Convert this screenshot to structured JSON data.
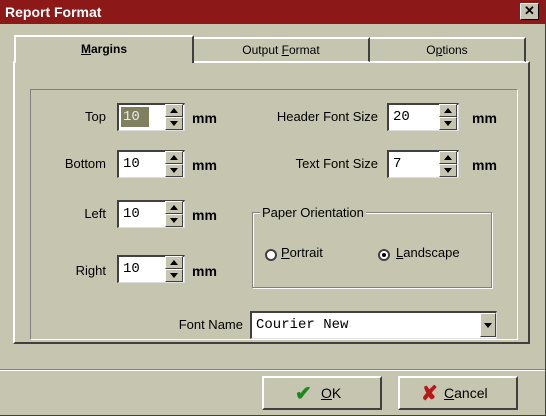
{
  "window": {
    "title": "Report Format",
    "close_glyph": "✕"
  },
  "tabs": [
    {
      "label_pre": "",
      "label_key": "M",
      "label_post": "argins"
    },
    {
      "label_pre": "Output ",
      "label_key": "F",
      "label_post": "ormat"
    },
    {
      "label_pre": "O",
      "label_key": "p",
      "label_post": "tions"
    }
  ],
  "margins": {
    "top": {
      "label": "Top",
      "value": "10",
      "unit": "mm"
    },
    "bottom": {
      "label": "Bottom",
      "value": "10",
      "unit": "mm"
    },
    "left": {
      "label": "Left",
      "value": "10",
      "unit": "mm"
    },
    "right": {
      "label": "Right",
      "value": "10",
      "unit": "mm"
    }
  },
  "header_font_size": {
    "label": "Header Font Size",
    "value": "20",
    "unit": "mm"
  },
  "text_font_size": {
    "label": "Text Font Size",
    "value": "7",
    "unit": "mm"
  },
  "paper_orientation": {
    "title": "Paper Orientation",
    "options": [
      {
        "key": "P",
        "rest": "ortrait",
        "selected": false
      },
      {
        "key": "L",
        "rest": "andscape",
        "selected": true
      }
    ]
  },
  "font_name": {
    "label": "Font Name",
    "value": "Courier New"
  },
  "buttons": {
    "ok": {
      "key": "O",
      "rest": "K",
      "icon": "check-icon",
      "color": "#1a8a1a"
    },
    "cancel": {
      "key": "C",
      "rest": "ancel",
      "icon": "x-icon",
      "color": "#b81818"
    }
  },
  "colors": {
    "title_bar": "#8c1818",
    "face": "#c6c6b0"
  }
}
